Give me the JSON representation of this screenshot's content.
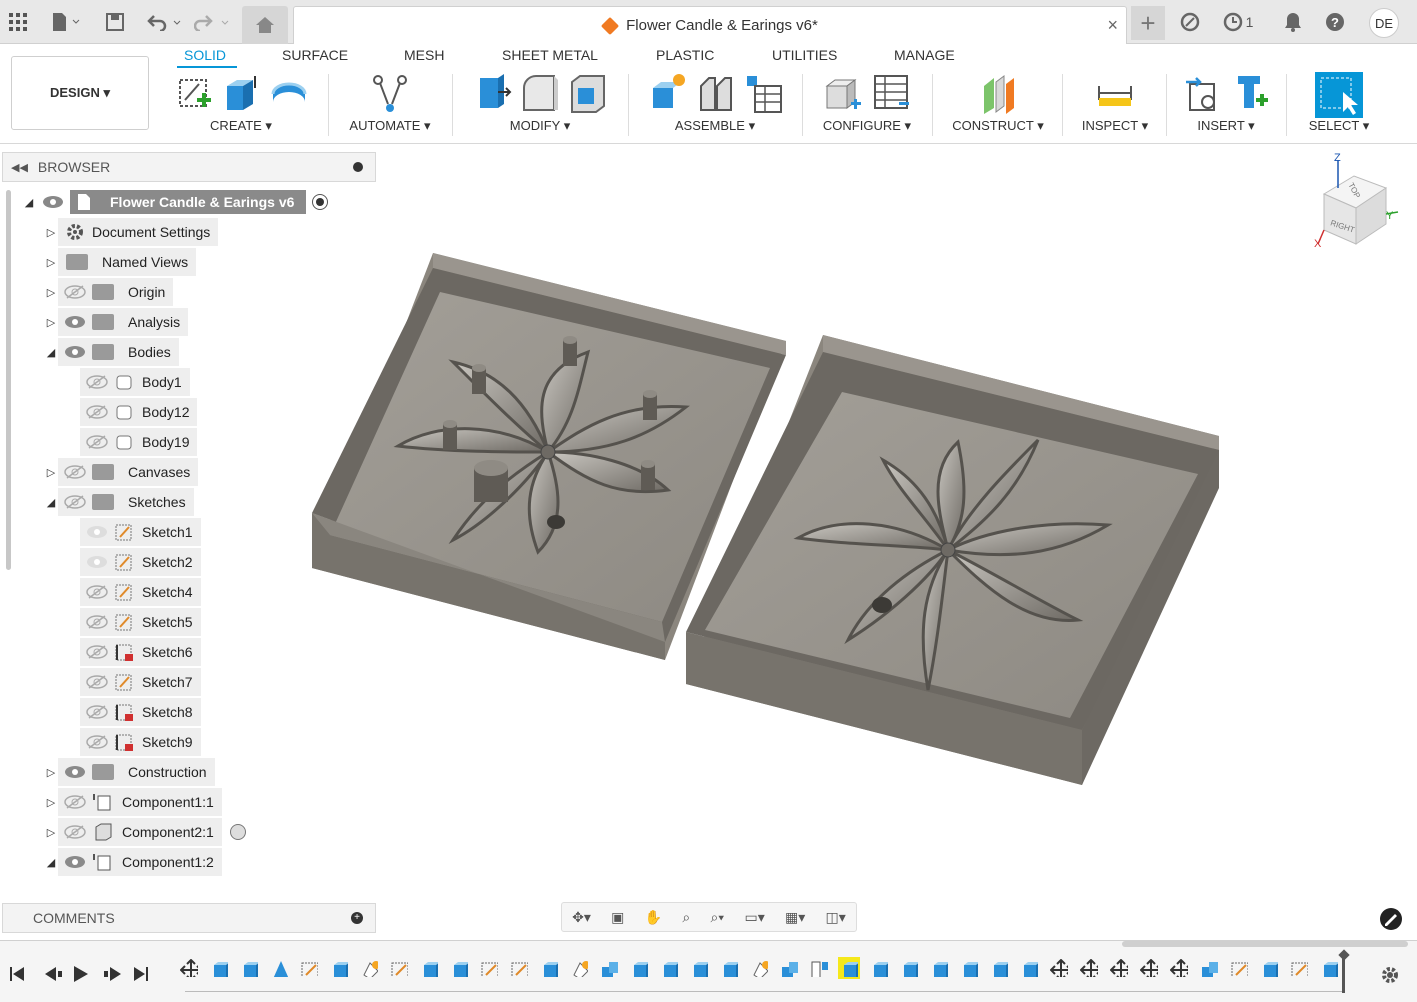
{
  "titlebar": {
    "doc_title": "Flower Candle & Earings v6*",
    "close": "×",
    "new_tab": "+",
    "jobs_count": "1",
    "user_initials": "DE"
  },
  "ribbon": {
    "workspace": "DESIGN ▾",
    "tabs": [
      "SOLID",
      "SURFACE",
      "MESH",
      "SHEET METAL",
      "PLASTIC",
      "UTILITIES",
      "MANAGE"
    ],
    "groups": [
      "CREATE ▾",
      "AUTOMATE ▾",
      "MODIFY ▾",
      "ASSEMBLE ▾",
      "CONFIGURE ▾",
      "CONSTRUCT ▾",
      "INSPECT ▾",
      "INSERT ▾",
      "SELECT ▾"
    ]
  },
  "browser": {
    "title": "BROWSER",
    "root": "Flower Candle & Earings v6",
    "items": [
      {
        "label": "Document Settings"
      },
      {
        "label": "Named Views"
      },
      {
        "label": "Origin"
      },
      {
        "label": "Analysis"
      },
      {
        "label": "Bodies"
      },
      {
        "label": "Body1"
      },
      {
        "label": "Body12"
      },
      {
        "label": "Body19"
      },
      {
        "label": "Canvases"
      },
      {
        "label": "Sketches"
      },
      {
        "label": "Sketch1"
      },
      {
        "label": "Sketch2"
      },
      {
        "label": "Sketch4"
      },
      {
        "label": "Sketch5"
      },
      {
        "label": "Sketch6"
      },
      {
        "label": "Sketch7"
      },
      {
        "label": "Sketch8"
      },
      {
        "label": "Sketch9"
      },
      {
        "label": "Construction"
      },
      {
        "label": "Component1:1"
      },
      {
        "label": "Component2:1"
      },
      {
        "label": "Component1:2"
      }
    ]
  },
  "comments": {
    "title": "COMMENTS"
  },
  "viewcube": {
    "top": "TOP",
    "right": "RIGHT",
    "axis_z": "Z",
    "axis_y": "Y",
    "axis_x": "X"
  },
  "colors": {
    "accent": "#0696d7",
    "model": "#8c877f",
    "highlight": "#f5e81b"
  }
}
